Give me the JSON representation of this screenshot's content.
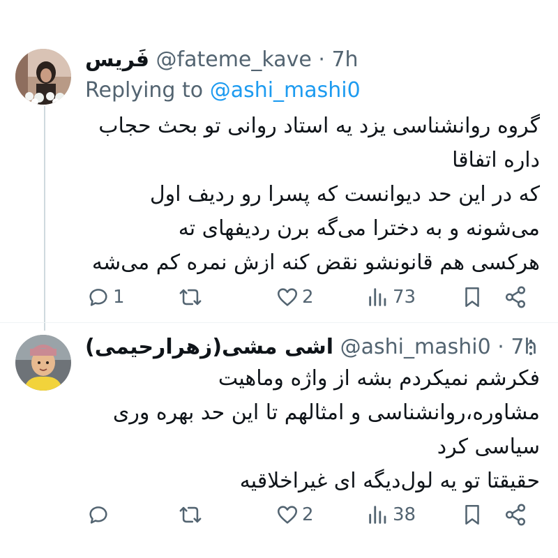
{
  "tweets": [
    {
      "display_name": "فَریس",
      "handle": "@fateme_kave",
      "separator": "·",
      "time": "7h",
      "replying_label": "Replying to",
      "replying_to": "@ashi_mashi0",
      "lines": [
        "گروه روانشناسی یزد یه استاد روانی تو بحث حجاب",
        "داره اتفاقا",
        "که در این حد دیوانست که پسرا رو ردیف اول",
        "می‌شونه و به دخترا می‌گه برن ردیفهای ته",
        "هرکسی هم قانونشو نقض کنه ازش نمره کم می‌شه"
      ],
      "replies": "1",
      "retweets": "",
      "likes": "2",
      "views": "73"
    },
    {
      "display_name": "اشی مشی(زهرارحیمی)",
      "handle": "@ashi_mashi0",
      "separator": "·",
      "time": "7h",
      "lines": [
        "فکرشم نمیکردم بشه از واژه وماهیت",
        "مشاوره،روانشناسی و امثالهم تا این حد بهره وری",
        "سیاسی کرد",
        "حقیقتا تو یه لول‌دیگه ای غیراخلاقیه"
      ],
      "replies": "",
      "retweets": "",
      "likes": "2",
      "views": "38"
    }
  ],
  "icons": {
    "reply": "reply-icon",
    "retweet": "retweet-icon",
    "like": "heart-icon",
    "views": "views-icon",
    "bookmark": "bookmark-icon",
    "share": "share-icon",
    "more": "more-icon"
  },
  "colors": {
    "text": "#0f1419",
    "secondary": "#536471",
    "link": "#1d9bf0",
    "thread_line": "#cfd9de"
  }
}
